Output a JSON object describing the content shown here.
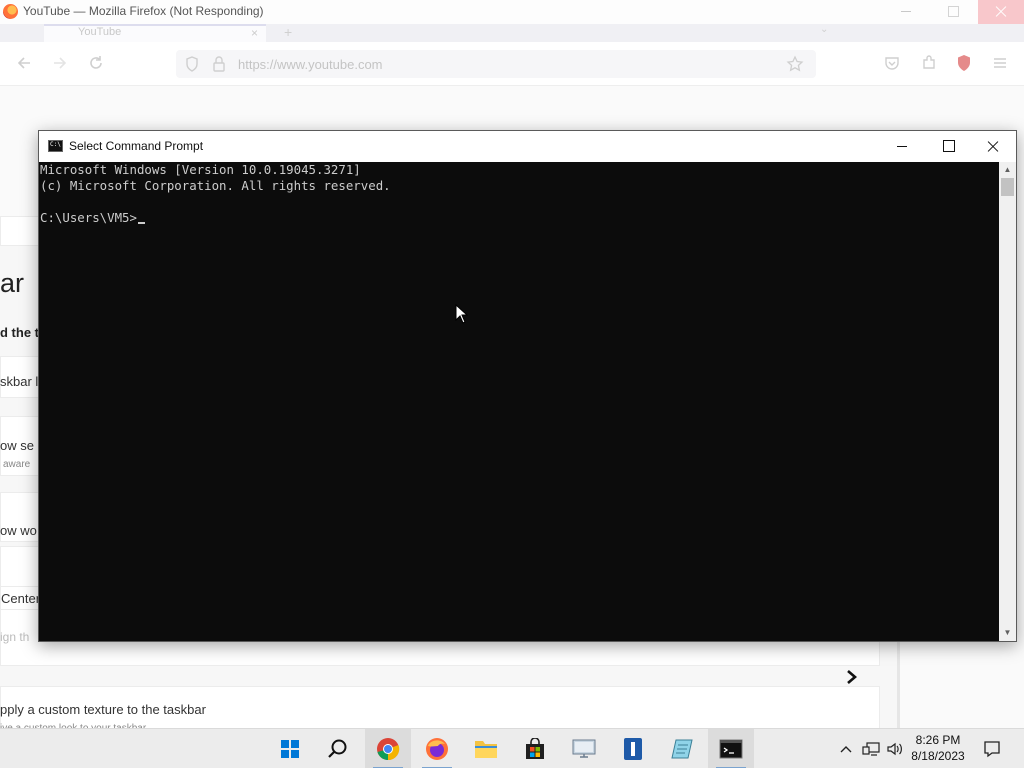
{
  "firefox": {
    "window_title": "YouTube — Mozilla Firefox (Not Responding)",
    "tab_label": "YouTube",
    "tab_close": "×",
    "new_tab": "+",
    "list_all_tabs": "⌄",
    "url": "https://www.youtube.com",
    "page": {
      "heading_fragment": "ar",
      "bold_fragment": "d the ta",
      "taskbar_fragment": "skbar l",
      "setting1_fragment": "ow se",
      "setting1_sub_fragment": "aware",
      "setting2_fragment": "ow wo",
      "center_fragment": "Center",
      "align_fragment": "ign th",
      "texture_title": "pply a custom texture to the taskbar",
      "texture_sub": "ive a custom look to your taskbar"
    }
  },
  "cmd": {
    "title": "Select Command Prompt",
    "lines": [
      "Microsoft Windows [Version 10.0.19045.3271]",
      "(c) Microsoft Corporation. All rights reserved.",
      "",
      "C:\\Users\\VM5>"
    ]
  },
  "taskbar": {
    "items": [
      {
        "name": "start-button",
        "icon": "windows-logo-icon"
      },
      {
        "name": "search-button",
        "icon": "search-icon"
      },
      {
        "name": "chrome-app",
        "icon": "chrome-icon"
      },
      {
        "name": "firefox-app",
        "icon": "firefox-icon"
      },
      {
        "name": "file-explorer-app",
        "icon": "folder-icon"
      },
      {
        "name": "microsoft-store-app",
        "icon": "store-icon"
      },
      {
        "name": "remote-desktop-app",
        "icon": "monitor-icon"
      },
      {
        "name": "blue-app",
        "icon": "blue-app-icon"
      },
      {
        "name": "notepad-app",
        "icon": "notepad-icon"
      },
      {
        "name": "terminal-app",
        "icon": "terminal-icon"
      }
    ],
    "time": "8:26 PM",
    "date": "8/18/2023",
    "accent": "#0078d7"
  }
}
